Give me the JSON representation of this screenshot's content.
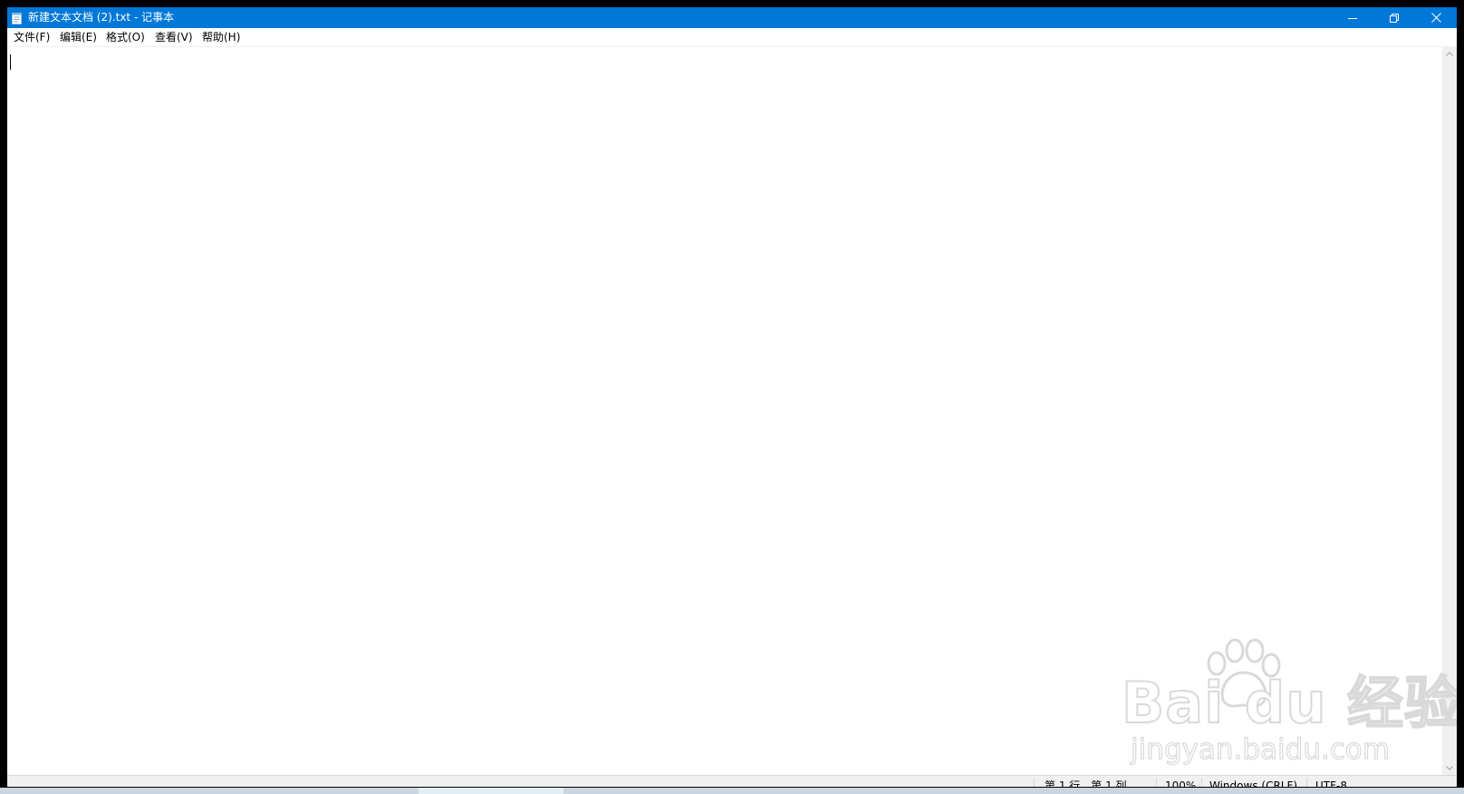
{
  "window": {
    "title": "新建文本文档 (2).txt - 记事本"
  },
  "menu": [
    {
      "label": "文件(F)"
    },
    {
      "label": "编辑(E)"
    },
    {
      "label": "格式(O)"
    },
    {
      "label": "查看(V)"
    },
    {
      "label": "帮助(H)"
    }
  ],
  "editor": {
    "content": ""
  },
  "status": {
    "position": "第 1 行，第 1 列",
    "zoom": "100%",
    "line_ending": "Windows (CRLF)",
    "encoding": "UTF-8"
  },
  "watermark": {
    "brand": "Bai du 经验",
    "url": "jingyan.baidu.com"
  },
  "colors": {
    "titlebar": "#0078d7",
    "chrome": "#f0f0f0",
    "text": "#000000"
  },
  "icons": {
    "app": "notepad-icon",
    "minimize": "minimize-icon",
    "maximize": "restore-icon",
    "close": "close-icon"
  }
}
